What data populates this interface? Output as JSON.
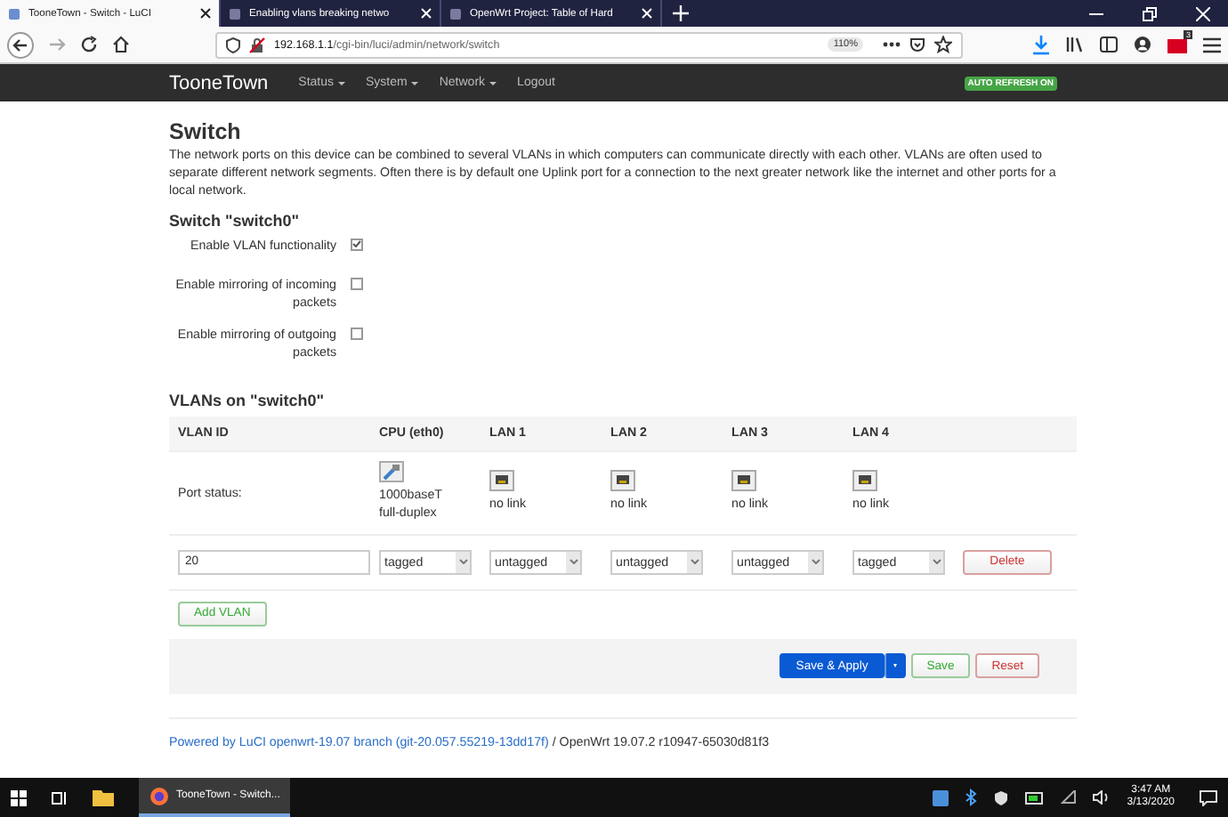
{
  "browser": {
    "tabs": [
      {
        "title": "TooneTown - Switch - LuCI",
        "selected": true
      },
      {
        "title": "Enabling vlans breaking netwo",
        "selected": false
      },
      {
        "title": "OpenWrt Project: Table of Hard",
        "selected": false
      }
    ],
    "url_host": "192.168.1.1",
    "url_path": "/cgi-bin/luci/admin/network/switch",
    "zoom": "110%",
    "notification_count": "3"
  },
  "header": {
    "brand": "TooneTown",
    "menu": [
      {
        "label": "Status",
        "dropdown": true
      },
      {
        "label": "System",
        "dropdown": true
      },
      {
        "label": "Network",
        "dropdown": true
      },
      {
        "label": "Logout",
        "dropdown": false
      }
    ],
    "badge": "AUTO REFRESH ON"
  },
  "page": {
    "title": "Switch",
    "description": "The network ports on this device can be combined to several VLANs in which computers can communicate directly with each other. VLANs are often used to separate different network segments. Often there is by default one Uplink port for a connection to the next greater network like the internet and other ports for a local network.",
    "section_title": "Switch \"switch0\"",
    "options": [
      {
        "label": "Enable VLAN functionality",
        "checked": true
      },
      {
        "label": "Enable mirroring of incoming packets",
        "checked": false
      },
      {
        "label": "Enable mirroring of outgoing packets",
        "checked": false
      }
    ],
    "vlans_title": "VLANs on \"switch0\"",
    "columns": [
      "VLAN ID",
      "CPU (eth0)",
      "LAN 1",
      "LAN 2",
      "LAN 3",
      "LAN 4"
    ],
    "port_status_label": "Port status:",
    "ports": [
      {
        "linked": true,
        "status": [
          "1000baseT",
          "full-duplex"
        ]
      },
      {
        "linked": false,
        "status": [
          "no link"
        ]
      },
      {
        "linked": false,
        "status": [
          "no link"
        ]
      },
      {
        "linked": false,
        "status": [
          "no link"
        ]
      },
      {
        "linked": false,
        "status": [
          "no link"
        ]
      }
    ],
    "rows": [
      {
        "vlan_id": "20",
        "modes": [
          "tagged",
          "untagged",
          "untagged",
          "untagged",
          "tagged"
        ],
        "delete": "Delete"
      }
    ],
    "add_button": "Add VLAN",
    "actions": {
      "save_apply": "Save & Apply",
      "save": "Save",
      "reset": "Reset"
    },
    "footer": {
      "link": "Powered by LuCI openwrt-19.07 branch (git-20.057.55219-13dd17f)",
      "text": "/ OpenWrt 19.07.2 r10947-65030d81f3"
    }
  },
  "taskbar": {
    "app": "TooneTown - Switch...",
    "time": "3:47 AM",
    "date": "3/13/2020"
  }
}
